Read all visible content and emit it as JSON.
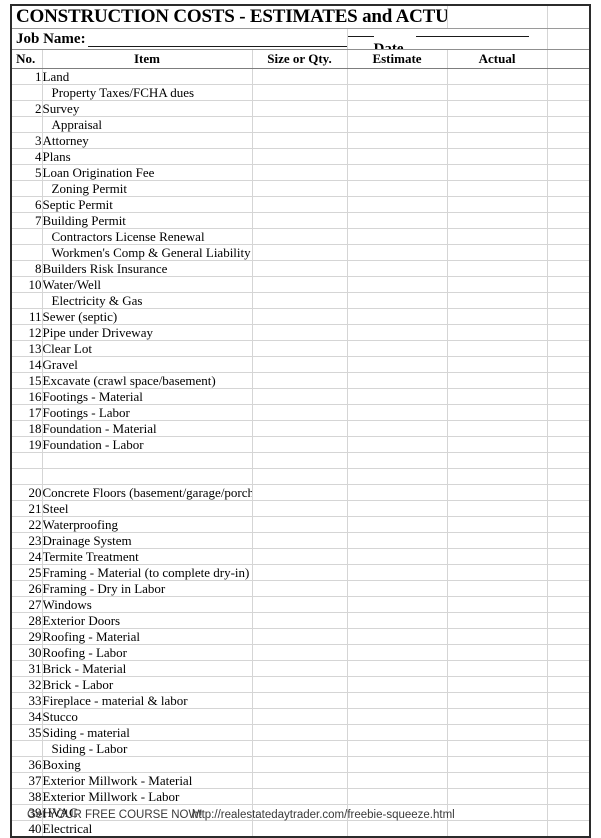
{
  "document": {
    "title": "CONSTRUCTION COSTS - ESTIMATES and ACTUAL",
    "job_name_label": "Job Name:",
    "job_name_value": "",
    "date_label": "Date",
    "date_value": ""
  },
  "columns": {
    "no": "No.",
    "item": "Item",
    "size": "Size or Qty.",
    "estimate": "Estimate",
    "actual": "Actual",
    "extra": ""
  },
  "rows": [
    {
      "no": "1",
      "item": "Land",
      "size": "",
      "estimate": "",
      "actual": ""
    },
    {
      "no": "",
      "item": "Property Taxes/FCHA dues",
      "size": "",
      "estimate": "",
      "actual": ""
    },
    {
      "no": "2",
      "item": "Survey",
      "size": "",
      "estimate": "",
      "actual": ""
    },
    {
      "no": "",
      "item": "Appraisal",
      "size": "",
      "estimate": "",
      "actual": ""
    },
    {
      "no": "3",
      "item": "Attorney",
      "size": "",
      "estimate": "",
      "actual": ""
    },
    {
      "no": "4",
      "item": "Plans",
      "size": "",
      "estimate": "",
      "actual": ""
    },
    {
      "no": "5",
      "item": "Loan Origination Fee",
      "size": "",
      "estimate": "",
      "actual": ""
    },
    {
      "no": "",
      "item": "Zoning Permit",
      "size": "",
      "estimate": "",
      "actual": ""
    },
    {
      "no": "6",
      "item": "Septic Permit",
      "size": "",
      "estimate": "",
      "actual": ""
    },
    {
      "no": "7",
      "item": "Building Permit",
      "size": "",
      "estimate": "",
      "actual": ""
    },
    {
      "no": "",
      "item": "Contractors License Renewal",
      "size": "",
      "estimate": "",
      "actual": ""
    },
    {
      "no": "",
      "item": "Workmen's Comp & General Liability",
      "size": "",
      "estimate": "",
      "actual": ""
    },
    {
      "no": "8",
      "item": "Builders Risk Insurance",
      "size": "",
      "estimate": "",
      "actual": ""
    },
    {
      "no": "10",
      "item": "Water/Well",
      "size": "",
      "estimate": "",
      "actual": ""
    },
    {
      "no": "",
      "item": "Electricity & Gas",
      "size": "",
      "estimate": "",
      "actual": ""
    },
    {
      "no": "11",
      "item": "Sewer (septic)",
      "size": "",
      "estimate": "",
      "actual": ""
    },
    {
      "no": "12",
      "item": "Pipe under Driveway",
      "size": "",
      "estimate": "",
      "actual": ""
    },
    {
      "no": "13",
      "item": "Clear Lot",
      "size": "",
      "estimate": "",
      "actual": ""
    },
    {
      "no": "14",
      "item": "Gravel",
      "size": "",
      "estimate": "",
      "actual": ""
    },
    {
      "no": "15",
      "item": "Excavate (crawl space/basement)",
      "size": "",
      "estimate": "",
      "actual": ""
    },
    {
      "no": "16",
      "item": "Footings - Material",
      "size": "",
      "estimate": "",
      "actual": ""
    },
    {
      "no": "17",
      "item": "Footings - Labor",
      "size": "",
      "estimate": "",
      "actual": ""
    },
    {
      "no": "18",
      "item": "Foundation - Material",
      "size": "",
      "estimate": "",
      "actual": ""
    },
    {
      "no": "19",
      "item": "Foundation - Labor",
      "size": "",
      "estimate": "",
      "actual": ""
    },
    {
      "no": "",
      "item": "",
      "size": "",
      "estimate": "",
      "actual": ""
    },
    {
      "no": "",
      "item": "",
      "size": "",
      "estimate": "",
      "actual": ""
    },
    {
      "no": "20",
      "item": "Concrete Floors (basement/garage/porch)",
      "size": "",
      "estimate": "",
      "actual": ""
    },
    {
      "no": "21",
      "item": "Steel",
      "size": "",
      "estimate": "",
      "actual": ""
    },
    {
      "no": "22",
      "item": "Waterproofing",
      "size": "",
      "estimate": "",
      "actual": ""
    },
    {
      "no": "23",
      "item": "Drainage System",
      "size": "",
      "estimate": "",
      "actual": ""
    },
    {
      "no": "24",
      "item": "Termite Treatment",
      "size": "",
      "estimate": "",
      "actual": ""
    },
    {
      "no": "25",
      "item": "Framing - Material (to complete dry-in)",
      "size": "",
      "estimate": "",
      "actual": ""
    },
    {
      "no": "26",
      "item": "Framing - Dry in Labor",
      "size": "",
      "estimate": "",
      "actual": ""
    },
    {
      "no": "27",
      "item": "Windows",
      "size": "",
      "estimate": "",
      "actual": ""
    },
    {
      "no": "28",
      "item": "Exterior Doors",
      "size": "",
      "estimate": "",
      "actual": ""
    },
    {
      "no": "29",
      "item": "Roofing - Material",
      "size": "",
      "estimate": "",
      "actual": ""
    },
    {
      "no": "30",
      "item": "Roofing - Labor",
      "size": "",
      "estimate": "",
      "actual": ""
    },
    {
      "no": "31",
      "item": "Brick - Material",
      "size": "",
      "estimate": "",
      "actual": ""
    },
    {
      "no": "32",
      "item": " Brick - Labor",
      "size": "",
      "estimate": "",
      "actual": ""
    },
    {
      "no": "33",
      "item": "Fireplace - material & labor",
      "size": "",
      "estimate": "",
      "actual": ""
    },
    {
      "no": "34",
      "item": "Stucco",
      "size": "",
      "estimate": "",
      "actual": ""
    },
    {
      "no": "35",
      "item": "Siding - material",
      "size": "",
      "estimate": "",
      "actual": ""
    },
    {
      "no": "",
      "item": "Siding - Labor",
      "size": "",
      "estimate": "",
      "actual": ""
    },
    {
      "no": "36",
      "item": "Boxing",
      "size": "",
      "estimate": "",
      "actual": ""
    },
    {
      "no": "37",
      "item": "Exterior Millwork - Material",
      "size": "",
      "estimate": "",
      "actual": ""
    },
    {
      "no": "38",
      "item": "Exterior Millwork - Labor",
      "size": "",
      "estimate": "",
      "actual": ""
    },
    {
      "no": "39",
      "item": "HVAC",
      "size": "",
      "estimate": "",
      "actual": ""
    },
    {
      "no": "40",
      "item": "Electrical",
      "size": "",
      "estimate": "",
      "actual": ""
    }
  ],
  "footer": {
    "promo_text": "Get YOUR FREE COURSE NOW!",
    "url": "http://realestatedaytrader.com/freebie-squeeze.html"
  }
}
